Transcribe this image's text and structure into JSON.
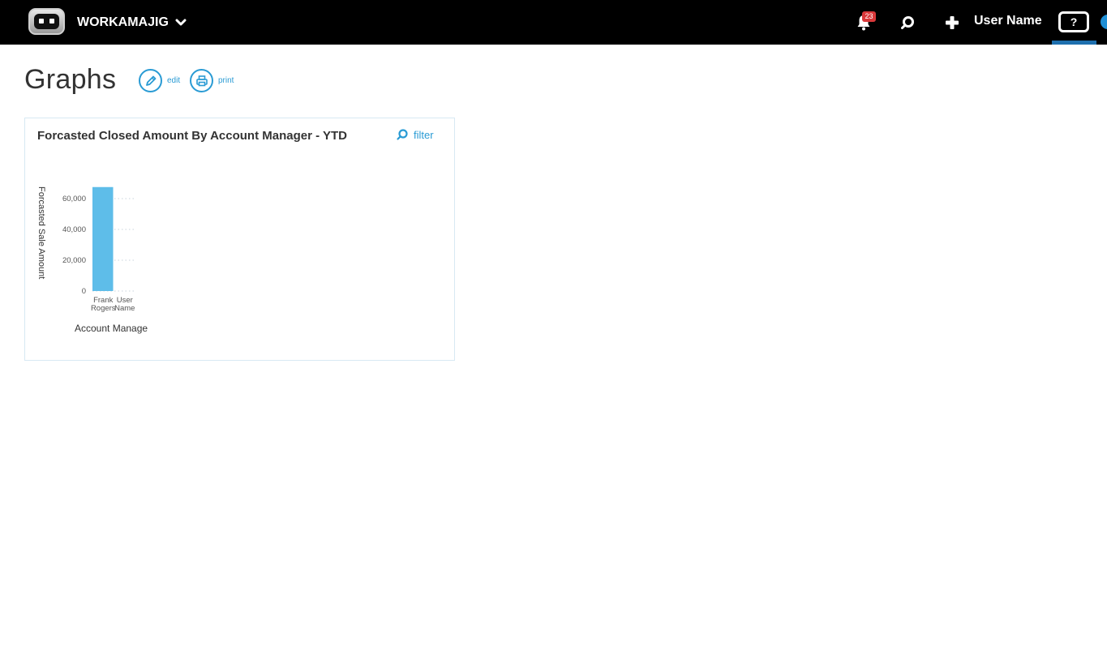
{
  "topbar": {
    "app_name": "WORKAMAJIG",
    "notification_count": "23",
    "user_name": "User Name",
    "help_label": "?"
  },
  "page": {
    "title": "Graphs",
    "edit_label": "edit",
    "print_label": "print"
  },
  "widget": {
    "title": "Forcasted Closed Amount By Account Manager - YTD",
    "filter_label": "filter"
  },
  "chart_data": {
    "type": "bar",
    "categories": [
      [
        "Frank",
        "Rogers"
      ],
      [
        "User",
        "Name"
      ]
    ],
    "values": [
      67500,
      0
    ],
    "ylabel": "Forcasted Sale Amount",
    "xlabel": "Account Manage",
    "yticks": [
      0,
      20000,
      40000,
      60000
    ],
    "ytick_labels": [
      "0",
      "20,000",
      "40,000",
      "60,000"
    ],
    "ylim": [
      0,
      70000
    ],
    "bar_color": "#5ebde9",
    "grid": "dotted"
  },
  "colors": {
    "accent": "#2a9bd4",
    "topbar": "#000000",
    "badge": "#d9383a"
  }
}
